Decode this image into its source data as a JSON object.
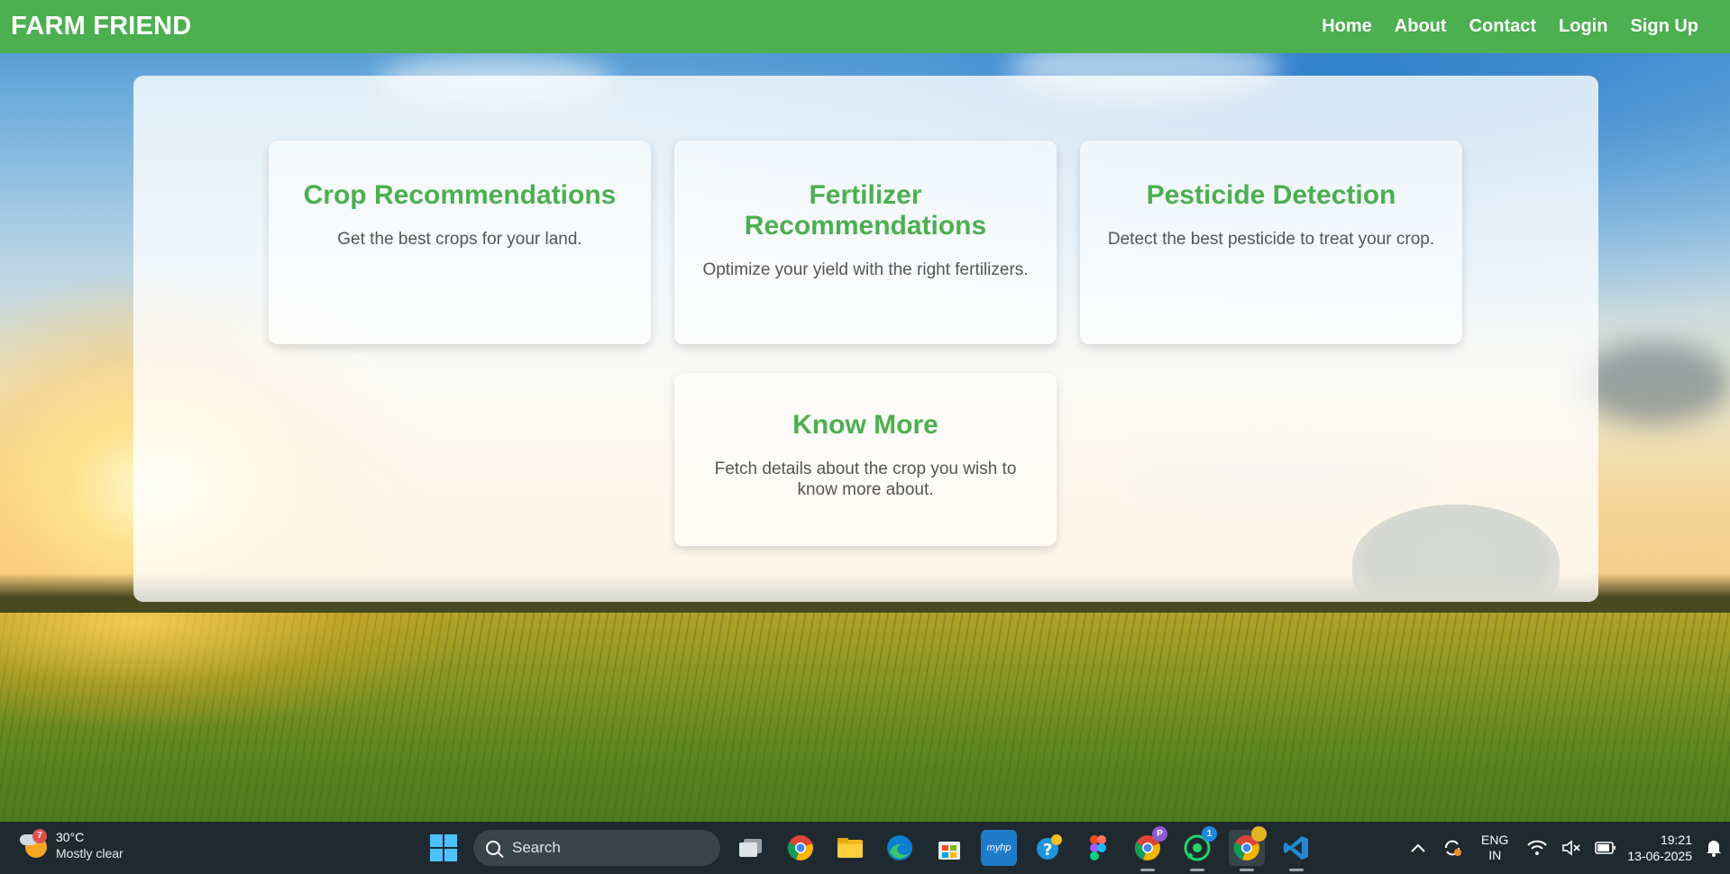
{
  "nav": {
    "brand": "FARM FRIEND",
    "links": [
      "Home",
      "About",
      "Contact",
      "Login",
      "Sign Up"
    ]
  },
  "cards": [
    {
      "title": "Crop Recommendations",
      "description": "Get the best crops for your land."
    },
    {
      "title": "Fertilizer Recommendations",
      "description": "Optimize your yield with the right fertilizers."
    },
    {
      "title": "Pesticide Detection",
      "description": "Detect the best pesticide to treat your crop."
    },
    {
      "title": "Know More",
      "description": "Fetch details about the crop you wish to know more about."
    }
  ],
  "taskbar": {
    "weather": {
      "badge": "7",
      "temp": "30°C",
      "condition": "Mostly clear"
    },
    "search_label": "Search",
    "badges": {
      "chrome_profile": "P",
      "whatsapp": "1"
    },
    "language": {
      "line1": "ENG",
      "line2": "IN"
    },
    "clock": {
      "time": "19:21",
      "date": "13-06-2025"
    }
  },
  "colors": {
    "primary": "#4caf50",
    "card_text": "#555555",
    "taskbar": "#1f2a30"
  }
}
